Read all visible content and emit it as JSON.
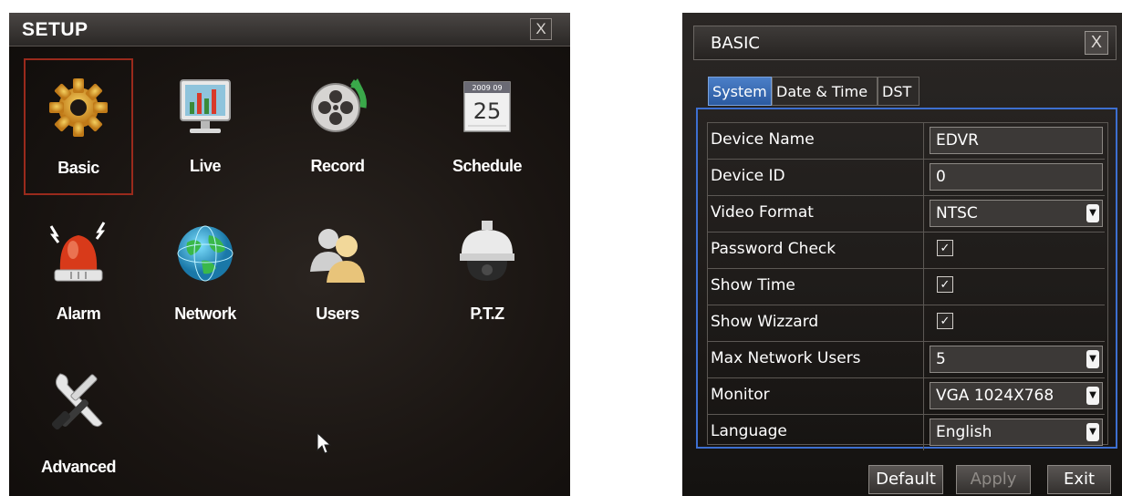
{
  "setup": {
    "title": "SETUP",
    "close_label": "X",
    "items": [
      {
        "label": "Basic",
        "icon": "gear-icon"
      },
      {
        "label": "Live",
        "icon": "monitor-chart-icon"
      },
      {
        "label": "Record",
        "icon": "film-reel-icon"
      },
      {
        "label": "Schedule",
        "icon": "calendar-icon"
      },
      {
        "label": "Alarm",
        "icon": "alarm-siren-icon"
      },
      {
        "label": "Network",
        "icon": "globe-icon"
      },
      {
        "label": "Users",
        "icon": "users-icon"
      },
      {
        "label": "P.T.Z",
        "icon": "dome-camera-icon"
      },
      {
        "label": "Advanced",
        "icon": "tools-icon"
      }
    ],
    "calendar_top": "2009 09",
    "calendar_day": "25"
  },
  "basic": {
    "title": "BASIC",
    "close_label": "X",
    "tabs": [
      {
        "label": "System"
      },
      {
        "label": "Date & Time"
      },
      {
        "label": "DST"
      }
    ],
    "fields": {
      "device_name": {
        "label": "Device Name",
        "value": "EDVR"
      },
      "device_id": {
        "label": "Device ID",
        "value": "0"
      },
      "video_format": {
        "label": "Video Format",
        "value": "NTSC"
      },
      "password_check": {
        "label": "Password Check",
        "checked": true
      },
      "show_time": {
        "label": "Show Time",
        "checked": true
      },
      "show_wizzard": {
        "label": "Show Wizzard",
        "checked": true
      },
      "max_network_users": {
        "label": "Max Network Users",
        "value": "5"
      },
      "monitor": {
        "label": "Monitor",
        "value": "VGA 1024X768"
      },
      "language": {
        "label": "Language",
        "value": "English"
      }
    },
    "buttons": {
      "default": "Default",
      "apply": "Apply",
      "exit": "Exit"
    }
  },
  "colors": {
    "selection_border": "#9a2a1c",
    "active_tab": "#2b5aa0",
    "panel_border": "#3d6fd0"
  }
}
